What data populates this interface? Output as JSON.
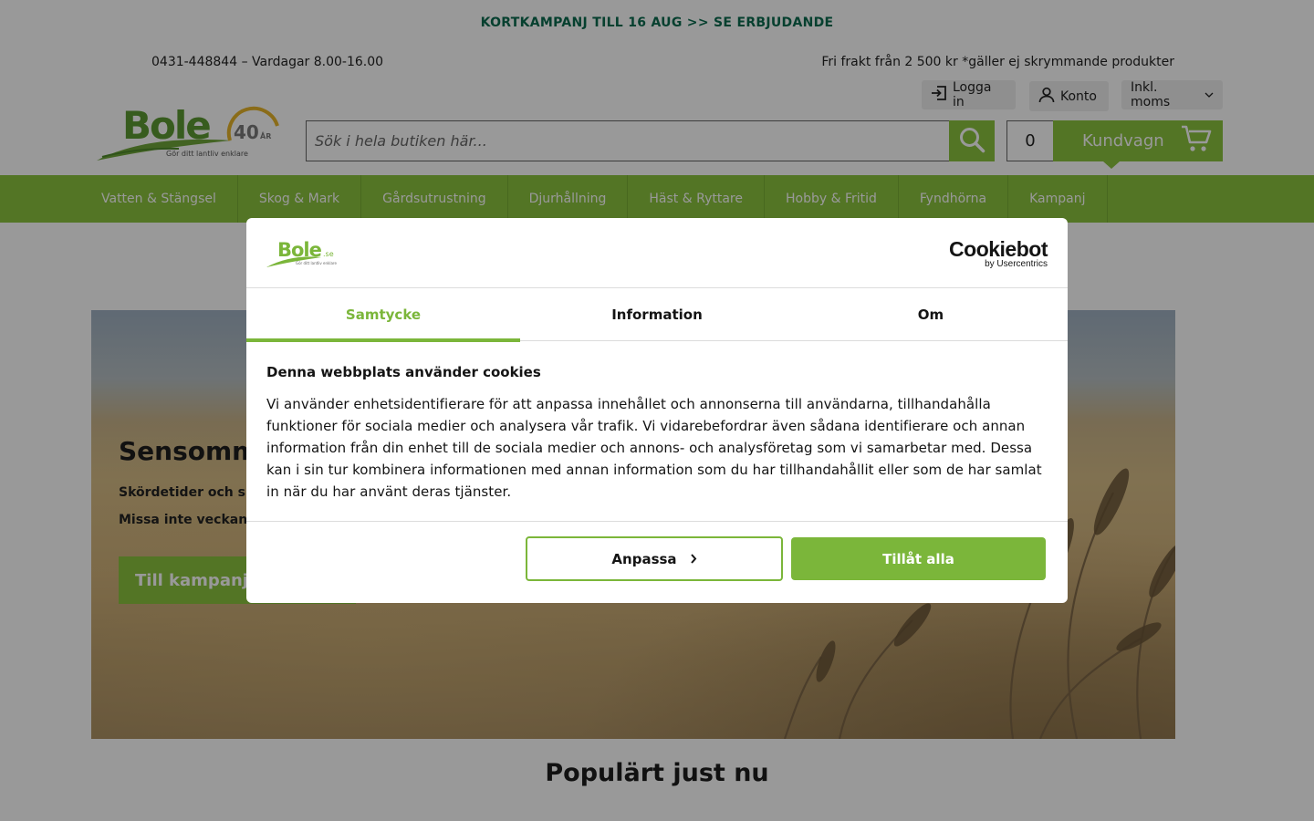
{
  "promo": {
    "text": "KORTKAMPANJ TILL 16 AUG >> SE ERBJUDANDE"
  },
  "info": {
    "phone": "0431-448844 – Vardagar 8.00-16.00",
    "freight": "Fri frakt från 2 500 kr *gäller ej skrymmande produkter"
  },
  "account": {
    "login": "Logga in",
    "account": "Konto",
    "vat": "Inkl. moms"
  },
  "logo": {
    "brand": "Bole",
    "badge": "40",
    "badge_suffix": "ÅR",
    "tagline": "Gör ditt lantliv enklare"
  },
  "search": {
    "placeholder": "Sök i hela butiken här..."
  },
  "cart": {
    "count": "0",
    "label": "Kundvagn"
  },
  "nav": {
    "items": [
      "Vatten & Stängsel",
      "Skog & Mark",
      "Gårdsutrustning",
      "Djurhållning",
      "Häst & Ryttare",
      "Hobby & Fritid",
      "Fyndhörna",
      "Kampanj"
    ]
  },
  "hero": {
    "title": "Sensomm",
    "line1": "Skördetider och s",
    "line2": "Missa inte veckan",
    "button": "Till kampanj"
  },
  "popular": {
    "title": "Populärt just nu"
  },
  "cookie": {
    "logo_brand": "Bole",
    "logo_suffix": ".se",
    "logo_tagline": "Gör ditt lantliv enklare",
    "provider": "Cookiebot",
    "provider_sub": "by Usercentrics",
    "tabs": [
      "Samtycke",
      "Information",
      "Om"
    ],
    "active_tab": "Samtycke",
    "heading": "Denna webbplats använder cookies",
    "body": "Vi använder enhetsidentifierare för att anpassa innehållet och annonserna till användarna, tillhandahålla funktioner för sociala medier och analysera vår trafik. Vi vidarebefordrar även sådana identifierare och annan information från din enhet till de sociala medier och annons- och analysföretag som vi samarbetar med. Dessa kan i sin tur kombinera informationen med annan information som du har tillhandahållit eller som de har samlat in när du har använt deras tjänster.",
    "customize": "Anpassa",
    "allow_all": "Tillåt alla"
  },
  "colors": {
    "brand_green": "#8ac33f",
    "dialog_green": "#7bb63a",
    "promo_teal": "#0b6b4f",
    "overlay": "rgba(0,0,0,0.40)"
  }
}
